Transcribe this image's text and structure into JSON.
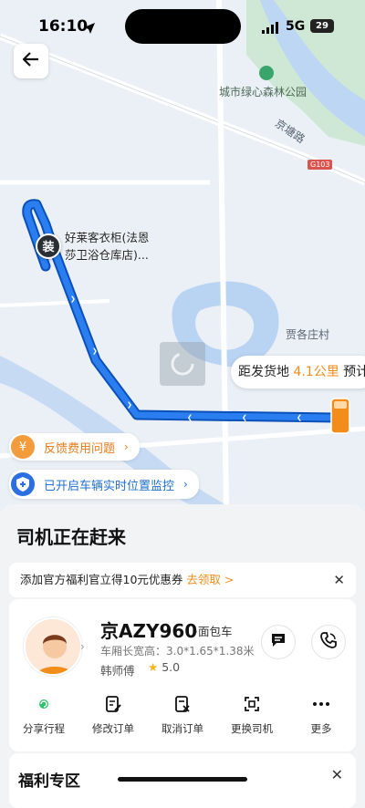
{
  "status_bar": {
    "time": "16:10",
    "network": "5G",
    "battery": "29"
  },
  "map": {
    "park_label": "城市绿心森林公园",
    "road_label": "京塘路",
    "highway_badge": "G103",
    "village_label": "贾各庄村",
    "pickup_pin_label": "装",
    "pickup_name": "好莱客衣柜(法恩莎卫浴仓库店)...",
    "distance_prefix": "距发货地",
    "distance_value": "4.1公里",
    "distance_suffix": "预计"
  },
  "chips": {
    "fee_feedback": "反馈费用问题",
    "monitor": "已开启车辆实时位置监控"
  },
  "sheet": {
    "title": "司机正在赶来",
    "coupon_text": "添加官方福利官立得10元优惠券",
    "coupon_link": "去领取 >",
    "driver": {
      "plate": "京AZY960",
      "vehicle_type": "·面包车",
      "dims_label": "车厢长宽高：3.0*1.65*1.38米",
      "name": "韩师傅",
      "rating": "5.0"
    },
    "actions": [
      {
        "label": "分享行程",
        "icon": "share-icon"
      },
      {
        "label": "修改订单",
        "icon": "edit-order-icon"
      },
      {
        "label": "取消订单",
        "icon": "cancel-order-icon"
      },
      {
        "label": "更换司机",
        "icon": "change-driver-icon"
      },
      {
        "label": "更多",
        "icon": "more-icon"
      }
    ],
    "welfare_title": "福利专区"
  },
  "colors": {
    "route": "#1a73e8",
    "accent_orange": "#f28c1b",
    "link_blue": "#1f6fd1"
  }
}
